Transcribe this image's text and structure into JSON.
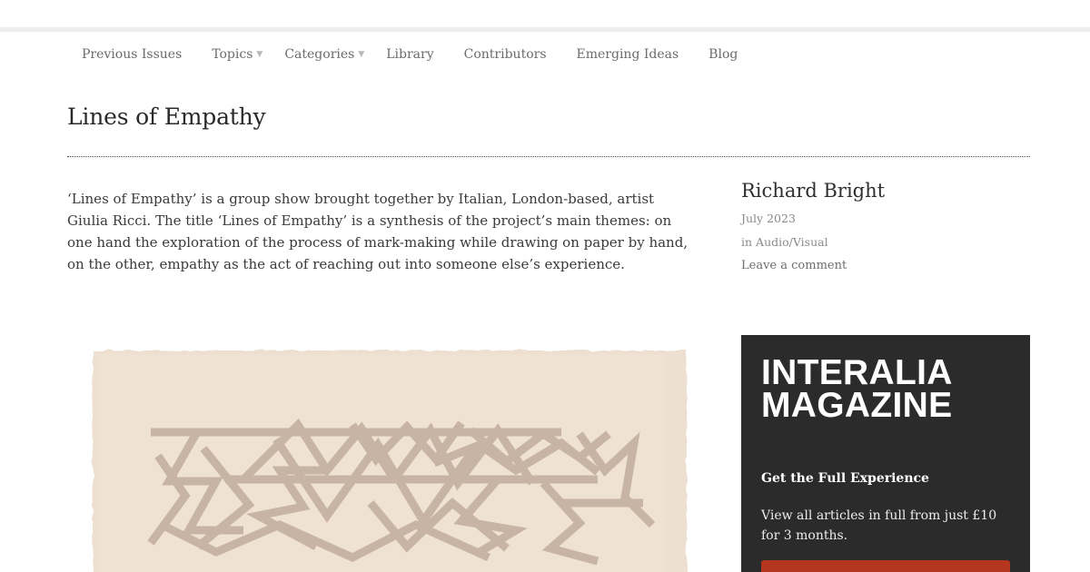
{
  "nav": {
    "items": [
      {
        "label": "Previous Issues",
        "has_caret": false
      },
      {
        "label": "Topics",
        "has_caret": true
      },
      {
        "label": "Categories",
        "has_caret": true
      },
      {
        "label": "Library",
        "has_caret": false
      },
      {
        "label": "Contributors",
        "has_caret": false
      },
      {
        "label": "Emerging Ideas",
        "has_caret": false
      },
      {
        "label": "Blog",
        "has_caret": false
      }
    ],
    "caret_glyph": "▼"
  },
  "article": {
    "title": "Lines of Empathy",
    "intro": "‘Lines of Empathy’ is a group show brought together by Italian, London-based, artist Giulia Ricci. The title ‘Lines of Empathy’ is a synthesis of the project’s main themes: on one hand the exploration of the process of mark-making while drawing on paper by hand, on the other, empathy as the act of reaching out into someone else’s experience."
  },
  "meta": {
    "author": "Richard Bright",
    "date": "July 2023",
    "category_prefix": "in",
    "category": "Audio/Visual",
    "comment_link": "Leave a comment"
  },
  "promo": {
    "brand_line1": "INTERALIA",
    "brand_line2": "MAGAZINE",
    "heading": "Get the Full Experience",
    "text": "View all articles in full from just £10 for 3 months."
  },
  "colors": {
    "accent": "#b5361e",
    "promo_bg": "#2b2b2b",
    "paper": "#eddccb",
    "ink": "#c2ad9c"
  }
}
